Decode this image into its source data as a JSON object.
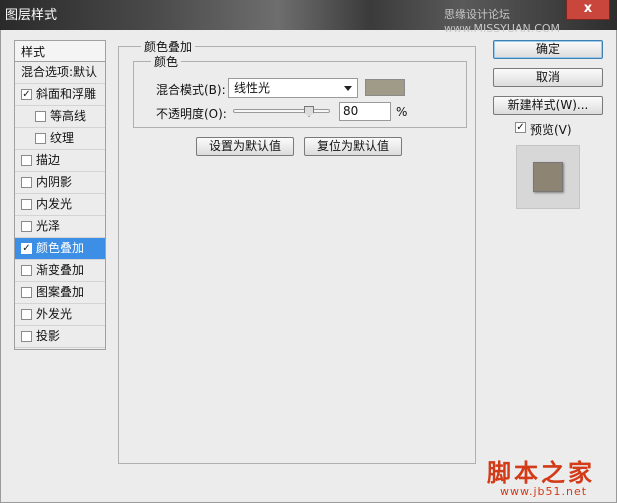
{
  "window": {
    "title": "图层样式",
    "watermark": "思缘设计论坛 www.MISSYUAN.COM",
    "close_label": "x"
  },
  "left_panel": {
    "header": "样式",
    "items": [
      {
        "label": "混合选项:默认",
        "checkbox": false,
        "checked": false,
        "indent": 0,
        "selected": false
      },
      {
        "label": "斜面和浮雕",
        "checkbox": true,
        "checked": true,
        "indent": 0,
        "selected": false
      },
      {
        "label": "等高线",
        "checkbox": true,
        "checked": false,
        "indent": 1,
        "selected": false
      },
      {
        "label": "纹理",
        "checkbox": true,
        "checked": false,
        "indent": 1,
        "selected": false
      },
      {
        "label": "描边",
        "checkbox": true,
        "checked": false,
        "indent": 0,
        "selected": false
      },
      {
        "label": "内阴影",
        "checkbox": true,
        "checked": false,
        "indent": 0,
        "selected": false
      },
      {
        "label": "内发光",
        "checkbox": true,
        "checked": false,
        "indent": 0,
        "selected": false
      },
      {
        "label": "光泽",
        "checkbox": true,
        "checked": false,
        "indent": 0,
        "selected": false
      },
      {
        "label": "颜色叠加",
        "checkbox": true,
        "checked": true,
        "indent": 0,
        "selected": true
      },
      {
        "label": "渐变叠加",
        "checkbox": true,
        "checked": false,
        "indent": 0,
        "selected": false
      },
      {
        "label": "图案叠加",
        "checkbox": true,
        "checked": false,
        "indent": 0,
        "selected": false
      },
      {
        "label": "外发光",
        "checkbox": true,
        "checked": false,
        "indent": 0,
        "selected": false
      },
      {
        "label": "投影",
        "checkbox": true,
        "checked": false,
        "indent": 0,
        "selected": false
      }
    ]
  },
  "main": {
    "group_title": "颜色叠加",
    "inner_title": "颜色",
    "blend_mode_label": "混合模式(B):",
    "blend_mode_value": "线性光",
    "overlay_color": "#a09a88",
    "opacity_label": "不透明度(O):",
    "opacity_value": "80",
    "opacity_unit": "%",
    "opacity_fraction": 0.8,
    "set_default_button": "设置为默认值",
    "reset_default_button": "复位为默认值"
  },
  "right_panel": {
    "ok_button": "确定",
    "cancel_button": "取消",
    "new_style_button": "新建样式(W)...",
    "preview_label": "预览(V)",
    "preview_checked": true,
    "preview_color": "#8e8473"
  },
  "branding": {
    "logo_text": "脚本之家",
    "logo_url": "www.jb51.net",
    "logo_color": "#d23a18"
  }
}
